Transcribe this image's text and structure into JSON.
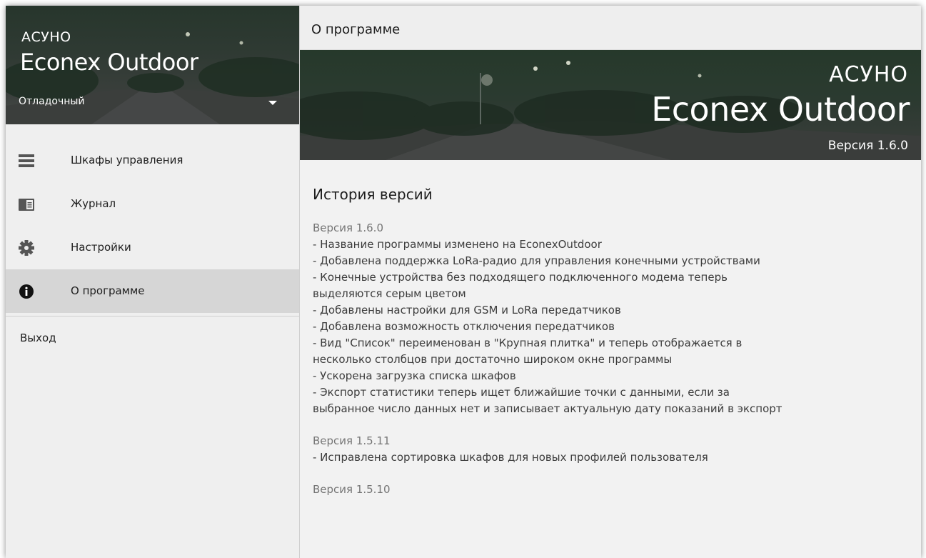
{
  "sidebar": {
    "app_small": "АСУНО",
    "app_big": "Econex Outdoor",
    "profile": "Отладочный",
    "menu": [
      {
        "label": "Шкафы управления",
        "icon": "list-icon"
      },
      {
        "label": "Журнал",
        "icon": "journal-icon"
      },
      {
        "label": "Настройки",
        "icon": "gear-icon"
      },
      {
        "label": "О программе",
        "icon": "info-icon",
        "active": true
      }
    ],
    "logout": "Выход"
  },
  "topbar": {
    "title": "О программе"
  },
  "banner": {
    "small": "АСУНО",
    "big": "Econex Outdoor",
    "version": "Версия 1.6.0"
  },
  "history": {
    "heading": "История версий",
    "versions": [
      {
        "title": "Версия 1.6.0",
        "lines": [
          "  - Название программы изменено на EconexOutdoor",
          "  - Добавлена поддержка LoRa-радио для управления конечными устройствами",
          "  - Конечные устройства без подходящего подключенного модема теперь",
          "выделяются серым цветом",
          "  - Добавлены настройки для GSM и LoRa передатчиков",
          "  - Добавлена возможность отключения передатчиков",
          "  - Вид \"Список\" переименован в \"Крупная плитка\" и теперь отображается в",
          "несколько столбцов при достаточно широком окне программы",
          "  - Ускорена загрузка списка шкафов",
          "  - Экспорт статистики теперь ищет ближайшие точки с данными, если за",
          "выбранное число данных нет и записывает актуальную дату показаний в экспорт"
        ]
      },
      {
        "title": "Версия 1.5.11",
        "lines": [
          "  - Исправлена сортировка шкафов для новых профилей пользователя"
        ]
      },
      {
        "title": "Версия 1.5.10",
        "lines": []
      }
    ]
  }
}
